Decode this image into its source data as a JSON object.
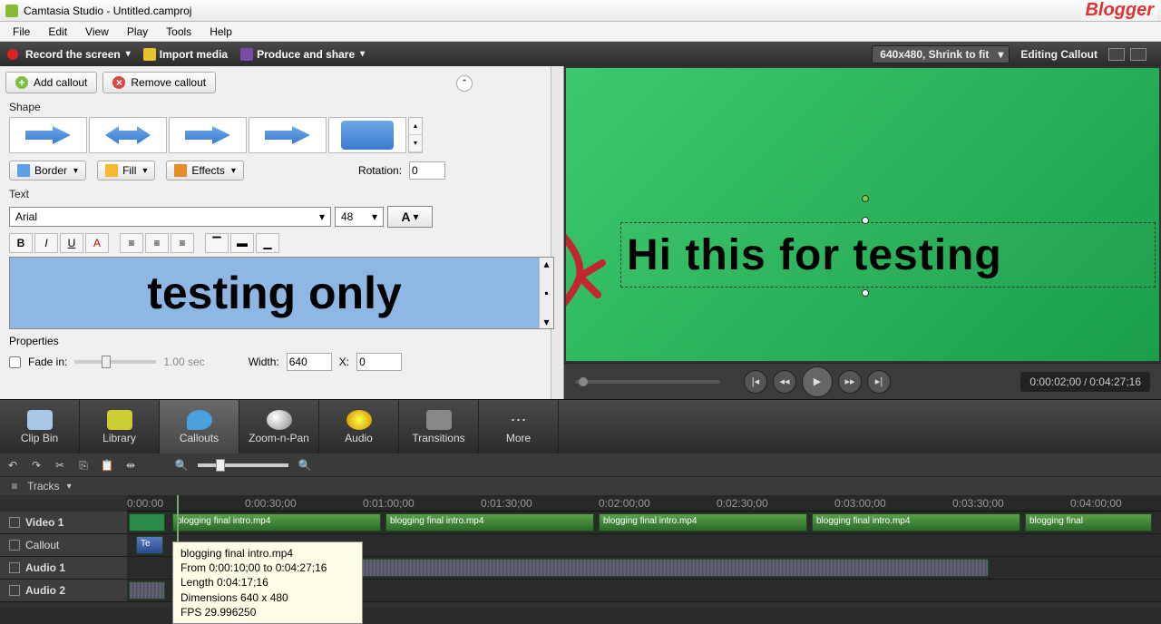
{
  "titlebar": {
    "app": "Camtasia Studio",
    "file": "Untitled.camproj"
  },
  "menu": [
    "File",
    "Edit",
    "View",
    "Play",
    "Tools",
    "Help"
  ],
  "toolbar": {
    "record": "Record the screen",
    "import": "Import media",
    "produce": "Produce and share"
  },
  "preview": {
    "resolution": "640x480, Shrink to fit",
    "title": "Editing Callout",
    "canvas_text": "Hi this for testing"
  },
  "callout": {
    "add": "Add callout",
    "remove": "Remove callout",
    "shape_label": "Shape",
    "border": "Border",
    "fill": "Fill",
    "effects": "Effects",
    "rotation_label": "Rotation:",
    "rotation": "0",
    "text_label": "Text",
    "font": "Arial",
    "size": "48",
    "textarea": "testing only",
    "props_label": "Properties",
    "fadein": "Fade in:",
    "fade_time": "1.00 sec",
    "width_label": "Width:",
    "width": "640",
    "x_label": "X:",
    "x": "0"
  },
  "tabs": [
    {
      "k": "clipbin",
      "label": "Clip Bin"
    },
    {
      "k": "library",
      "label": "Library"
    },
    {
      "k": "callouts",
      "label": "Callouts"
    },
    {
      "k": "zoom",
      "label": "Zoom-n-Pan"
    },
    {
      "k": "audio",
      "label": "Audio"
    },
    {
      "k": "trans",
      "label": "Transitions"
    },
    {
      "k": "more",
      "label": "More"
    }
  ],
  "playback": {
    "current": "0:00:02;00",
    "total": "0:04:27;16"
  },
  "timeline": {
    "tracks_label": "Tracks",
    "ruler": [
      "0:00:00",
      "0:00:30;00",
      "0:01:00;00",
      "0:01:30;00",
      "0:02:00;00",
      "0:02:30;00",
      "0:03:00;00",
      "0:03:30;00",
      "0:04:00;00"
    ],
    "tracks": [
      {
        "name": "Video 1"
      },
      {
        "name": "Callout"
      },
      {
        "name": "Audio 1"
      },
      {
        "name": "Audio 2"
      }
    ],
    "clip_name": "blogging final intro.mp4",
    "callout_clip": "Te"
  },
  "tooltip": {
    "name": "blogging final intro.mp4",
    "from": "From 0:00:10;00 to 0:04:27;16",
    "length": "Length 0:04:17;16",
    "dim": "Dimensions 640 x 480",
    "fps": "FPS 29.996250"
  },
  "watermark": "Blogger"
}
